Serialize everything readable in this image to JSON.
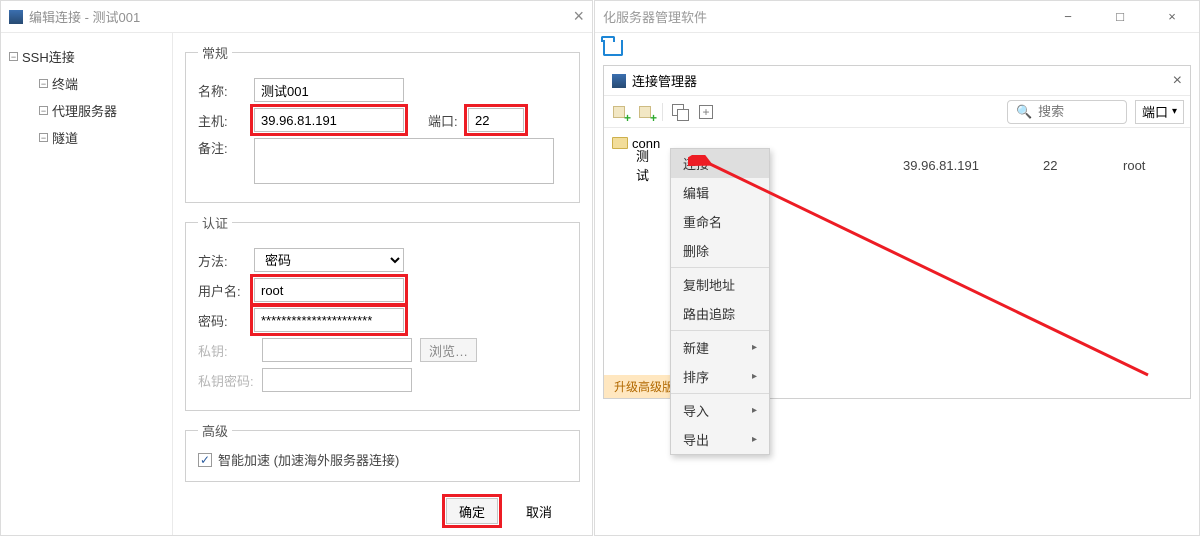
{
  "dialog": {
    "title": "编辑连接 - 测试001",
    "tree": {
      "root": "SSH连接",
      "items": [
        "终端",
        "代理服务器",
        "隧道"
      ]
    },
    "group_general": "常规",
    "name_label": "名称:",
    "name_value": "测试001",
    "host_label": "主机:",
    "host_value": "39.96.81.191",
    "port_label": "端口:",
    "port_value": "22",
    "note_label": "备注:",
    "note_value": "",
    "group_auth": "认证",
    "method_label": "方法:",
    "method_value": "密码",
    "user_label": "用户名:",
    "user_value": "root",
    "pwd_label": "密码:",
    "pwd_value": "**********************",
    "key_label": "私钥:",
    "keypass_label": "私钥密码:",
    "browse": "浏览…",
    "group_adv": "高级",
    "accel_label": "智能加速 (加速海外服务器连接)",
    "ok": "确定",
    "cancel": "取消"
  },
  "bgwin": {
    "title_frag": "化服务器管理软件"
  },
  "panel": {
    "title": "连接管理器",
    "search_placeholder": "搜索",
    "port_btn": "端口",
    "folder": "conn",
    "row": {
      "name": "测试",
      "host": "39.96.81.191",
      "port": "22",
      "user": "root"
    },
    "upgrade": "升级高级版"
  },
  "menu": {
    "connect": "连接",
    "edit": "编辑",
    "rename": "重命名",
    "delete": "删除",
    "copy_addr": "复制地址",
    "traceroute": "路由追踪",
    "new": "新建",
    "sort": "排序",
    "import": "导入",
    "export": "导出"
  }
}
